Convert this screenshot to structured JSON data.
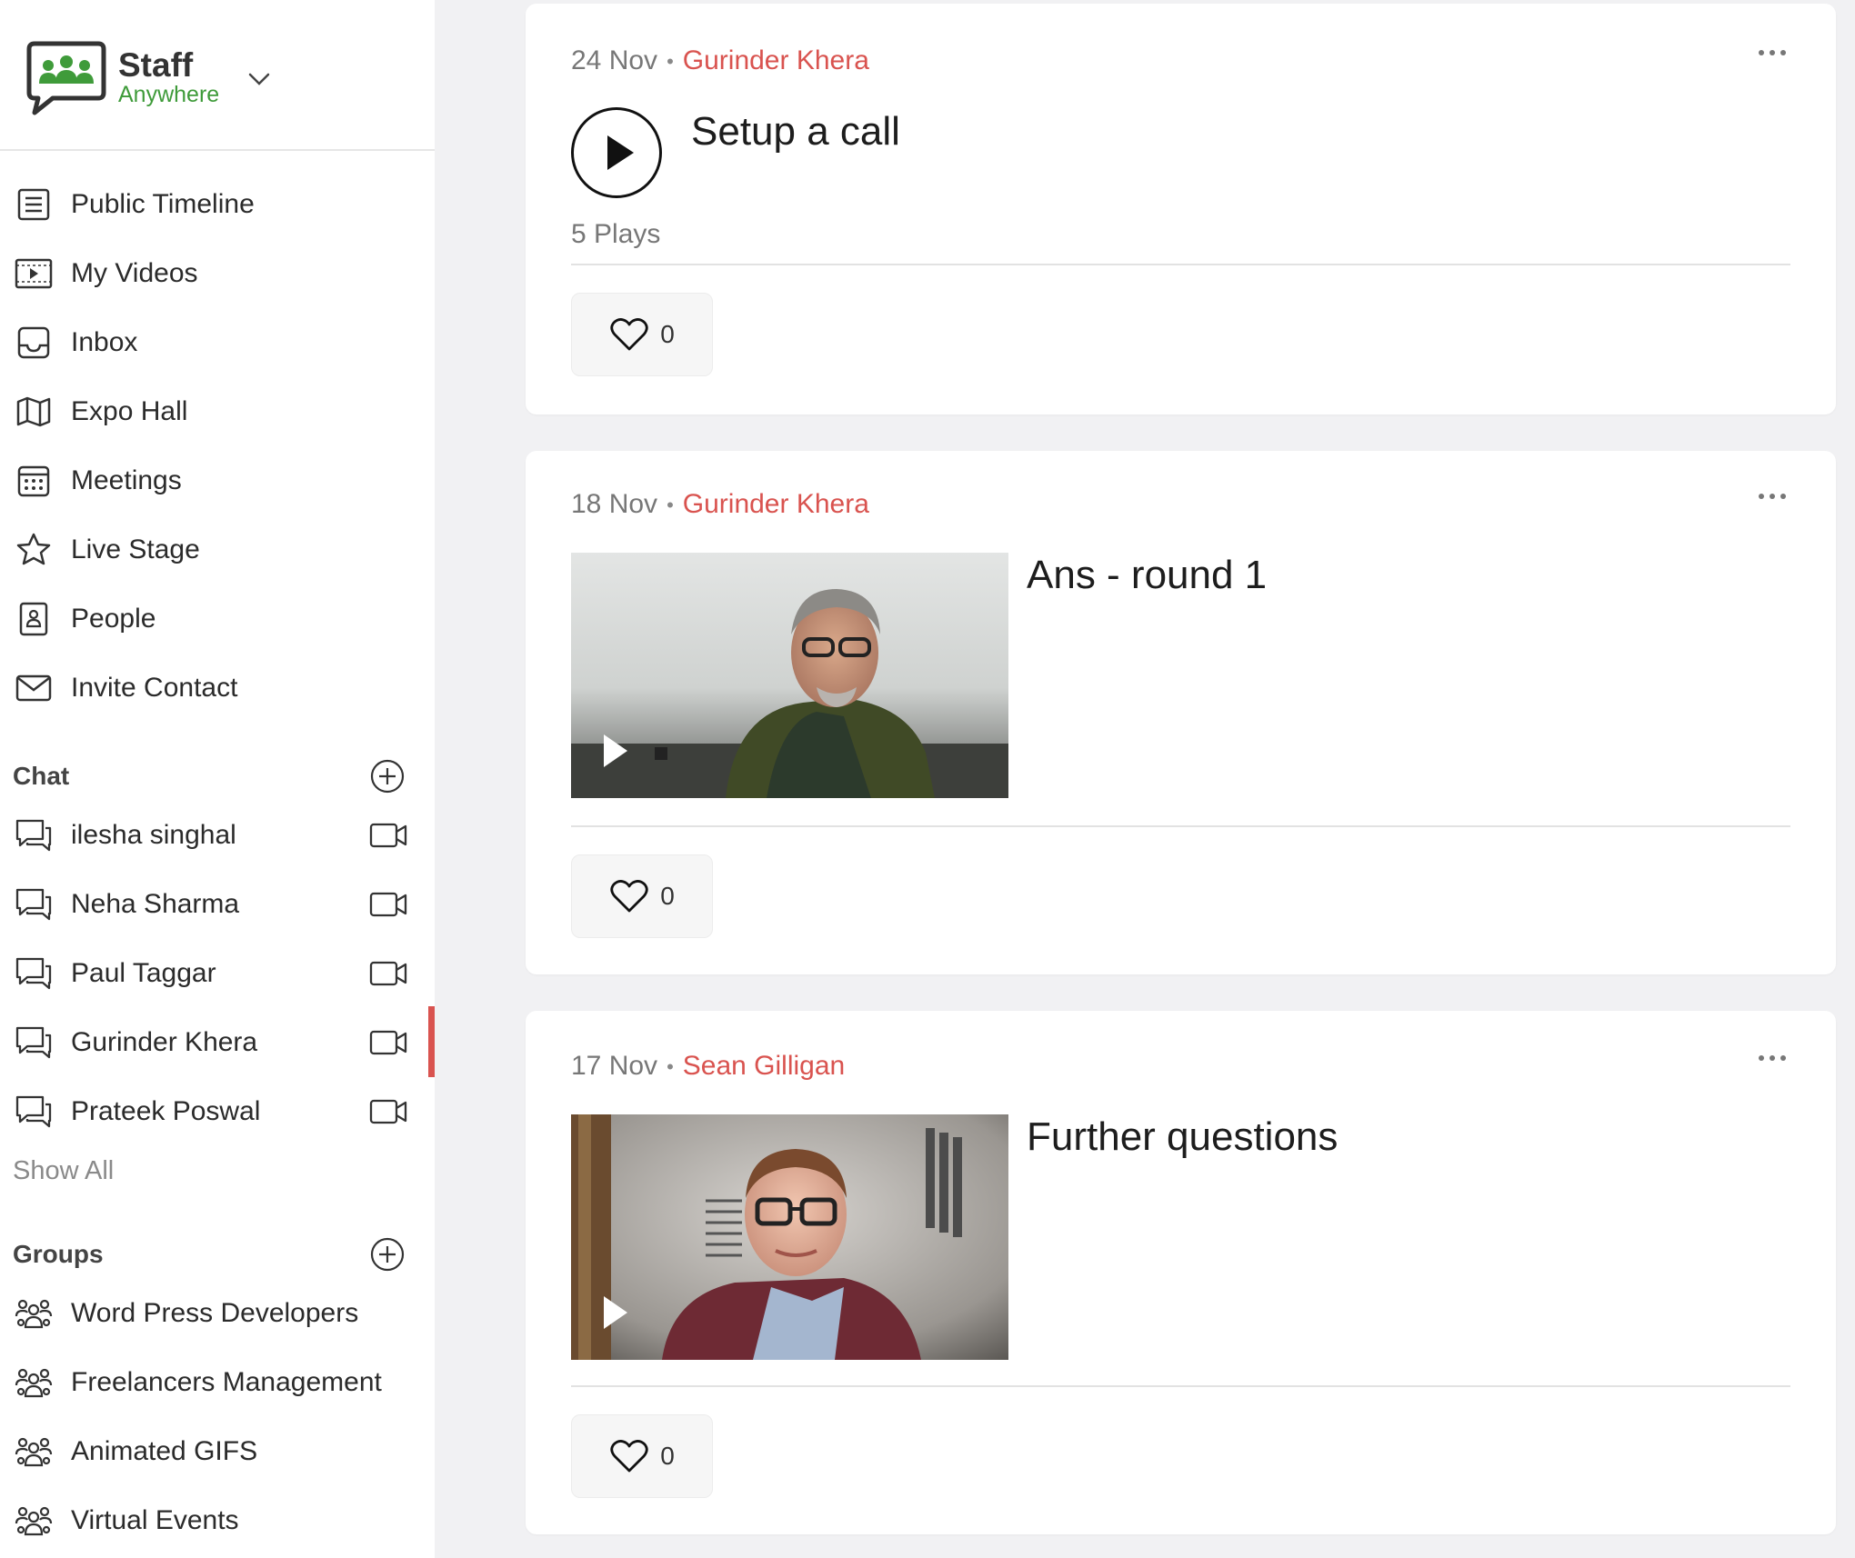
{
  "brand": {
    "title": "Staff",
    "subtitle": "Anywhere"
  },
  "nav": [
    {
      "label": "Public Timeline",
      "icon": "list-icon"
    },
    {
      "label": "My Videos",
      "icon": "video-film-icon"
    },
    {
      "label": "Inbox",
      "icon": "inbox-icon"
    },
    {
      "label": "Expo Hall",
      "icon": "map-icon"
    },
    {
      "label": "Meetings",
      "icon": "calendar-icon"
    },
    {
      "label": "Live Stage",
      "icon": "star-icon"
    },
    {
      "label": "People",
      "icon": "contact-book-icon"
    },
    {
      "label": "Invite Contact",
      "icon": "envelope-icon"
    }
  ],
  "chat": {
    "heading": "Chat",
    "items": [
      {
        "name": "ilesha singhal"
      },
      {
        "name": "Neha Sharma"
      },
      {
        "name": "Paul Taggar"
      },
      {
        "name": "Gurinder Khera"
      },
      {
        "name": "Prateek Poswal"
      }
    ],
    "show_all": "Show All"
  },
  "groups": {
    "heading": "Groups",
    "items": [
      {
        "name": "Word Press Developers"
      },
      {
        "name": "Freelancers Management"
      },
      {
        "name": "Animated GIFS"
      },
      {
        "name": "Virtual Events"
      }
    ]
  },
  "feed": [
    {
      "date": "24 Nov",
      "author": "Gurinder Khera",
      "title": "Setup a call",
      "plays": "5 Plays",
      "likes": "0",
      "media": "audio"
    },
    {
      "date": "18 Nov",
      "author": "Gurinder Khera",
      "title": "Ans - round 1",
      "likes": "0",
      "media": "video"
    },
    {
      "date": "17 Nov",
      "author": "Sean Gilligan",
      "title": "Further questions",
      "likes": "0",
      "media": "video"
    }
  ],
  "colors": {
    "accent": "#d9534f",
    "brand_green": "#3f9b3a",
    "background": "#f1f1f3"
  }
}
